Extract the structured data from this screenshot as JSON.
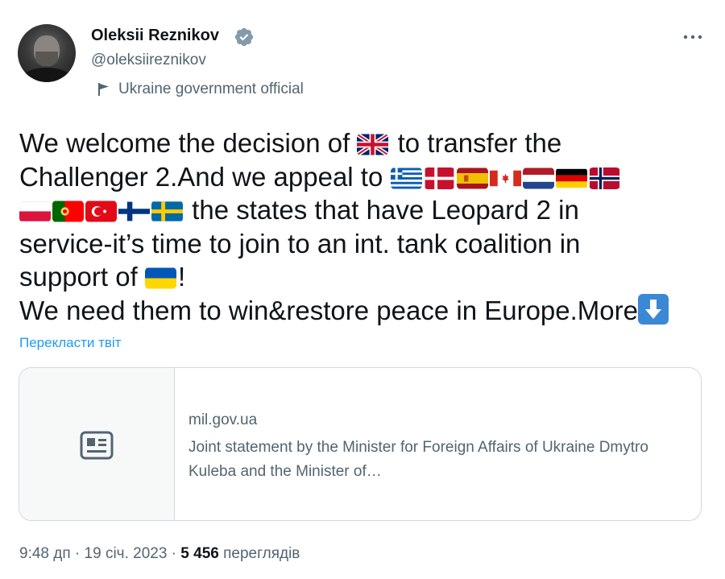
{
  "author": {
    "name": "Oleksii Reznikov",
    "handle": "@oleksiireznikov",
    "affiliation": "Ukraine government official",
    "verified_icon": "verified-badge-icon",
    "affiliation_icon": "flag-icon"
  },
  "tweet": {
    "line1_a": "We welcome the decision of ",
    "line1_b": " to transfer the",
    "line2_a": "Challenger 2.And we appeal to ",
    "line3_b": " the states that have Leopard 2 in",
    "line4": "service-it’s time to join to an int. tank coalition in",
    "line5_a": "support of ",
    "line5_b": "!",
    "line6_a": "We need them to win&restore peace in Europe.More",
    "flags_line2": [
      "Greece",
      "Denmark",
      "Spain",
      "Canada",
      "Netherlands",
      "Germany",
      "Norway"
    ],
    "flags_line3": [
      "Poland",
      "Portugal",
      "Turkey",
      "Finland",
      "Sweden"
    ]
  },
  "translate_label": "Перекласти твіт",
  "card": {
    "domain": "mil.gov.ua",
    "description": "Joint statement by the Minister for Foreign Affairs of Ukraine Dmytro Kuleba and the Minister of…",
    "icon": "article-icon"
  },
  "meta": {
    "time": "9:48 дп",
    "separator": " · ",
    "date": "19 січ. 2023",
    "views_count": "5 456",
    "views_label": " переглядів"
  },
  "colors": {
    "accent": "#1d9bf0",
    "secondary_text": "#536471",
    "primary_text": "#0f1419",
    "border": "#cfd9de"
  }
}
